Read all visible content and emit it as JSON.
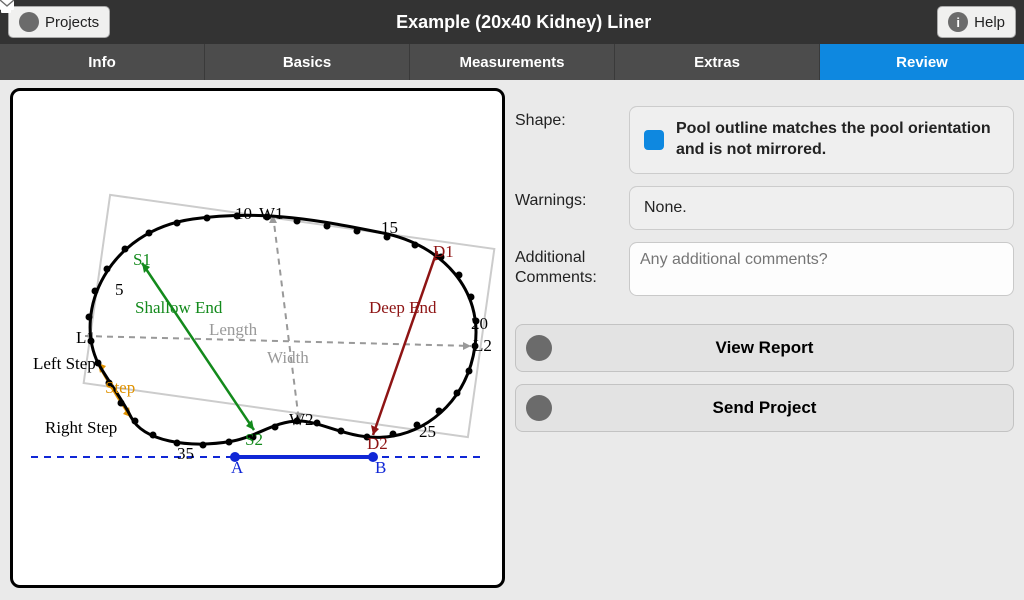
{
  "header": {
    "projects_label": "Projects",
    "title": "Example (20x40 Kidney) Liner",
    "help_label": "Help"
  },
  "tabs": [
    "Info",
    "Basics",
    "Measurements",
    "Extras",
    "Review"
  ],
  "active_tab": 4,
  "review": {
    "shape_label": "Shape:",
    "shape_text": "Pool outline matches the pool orientation and is not mirrored.",
    "warnings_label": "Warnings:",
    "warnings_text": "None.",
    "comments_label": "Additional Comments:",
    "comments_placeholder": "Any additional comments?",
    "view_report": "View Report",
    "send_project": "Send Project"
  },
  "diagram": {
    "labels": {
      "left_step": "Left Step",
      "right_step": "Right Step",
      "step": "Step",
      "shallow_end": "Shallow End",
      "deep_end": "Deep End",
      "length": "Length",
      "width": "Width",
      "S1": "S1",
      "S2": "S2",
      "D1": "D1",
      "D2": "D2",
      "W1": "W1",
      "W2": "W2",
      "L1": "L1",
      "L2": "L2",
      "A": "A",
      "B": "B",
      "n5": "5",
      "n10": "10",
      "n15": "15",
      "n20": "20",
      "n25": "25",
      "n35": "35"
    },
    "colors": {
      "outline": "#000000",
      "shallow": "#138a1c",
      "deep": "#8e1414",
      "step": "#e09200",
      "axis": "#999999",
      "ab": "#1027d6"
    }
  }
}
